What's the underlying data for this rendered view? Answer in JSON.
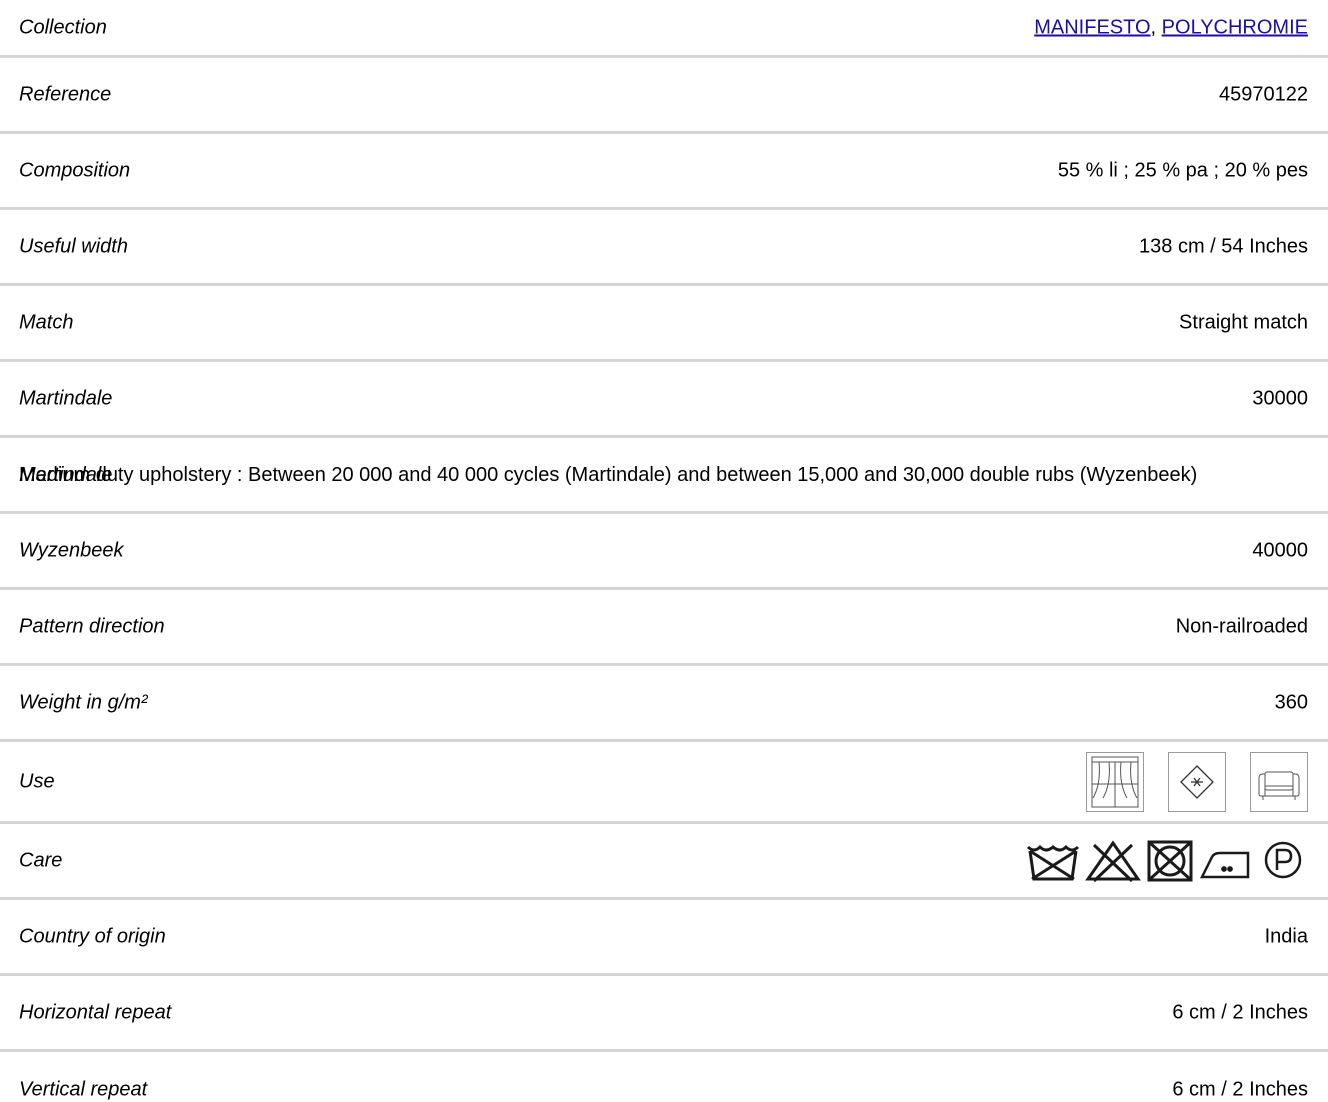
{
  "rows": [
    {
      "label": "Collection",
      "links": [
        "MANIFESTO",
        "POLYCHROMIE"
      ],
      "separator": ", "
    },
    {
      "label": "Reference",
      "value": "45970122"
    },
    {
      "label": "Composition",
      "value": "55 % li ; 25 % pa ; 20 % pes"
    },
    {
      "label": "Useful width",
      "value": "138 cm / 54 Inches"
    },
    {
      "label": "Match",
      "value": "Straight match"
    },
    {
      "label": "Martindale",
      "value": "30000"
    },
    {
      "label": "Martindale",
      "note": "Medium duty upholstery : Between 20 000 and 40 000 cycles (Martindale) and between 15,000 and 30,000 double rubs (Wyzenbeek)"
    },
    {
      "label": "Wyzenbeek",
      "value": "40000"
    },
    {
      "label": "Pattern direction",
      "value": "Non-railroaded"
    },
    {
      "label": "Weight in g/m²",
      "value": "360"
    },
    {
      "label": "Use",
      "icons": [
        "curtain-icon",
        "no-cross-diamond-icon",
        "armchair-icon"
      ]
    },
    {
      "label": "Care",
      "icons": [
        "no-wash-icon",
        "no-bleach-icon",
        "no-tumble-dry-icon",
        "iron-low-heat-icon",
        "professional-dry-clean-p-icon"
      ]
    },
    {
      "label": "Country of origin",
      "value": "India"
    },
    {
      "label": "Horizontal repeat",
      "value": "6 cm / 2 Inches"
    },
    {
      "label": "Vertical repeat",
      "value": "6 cm / 2 Inches"
    }
  ],
  "colors": {
    "link": "#1a0dab",
    "divider": "#d4d4d4",
    "icon": "#1a1a1a"
  }
}
